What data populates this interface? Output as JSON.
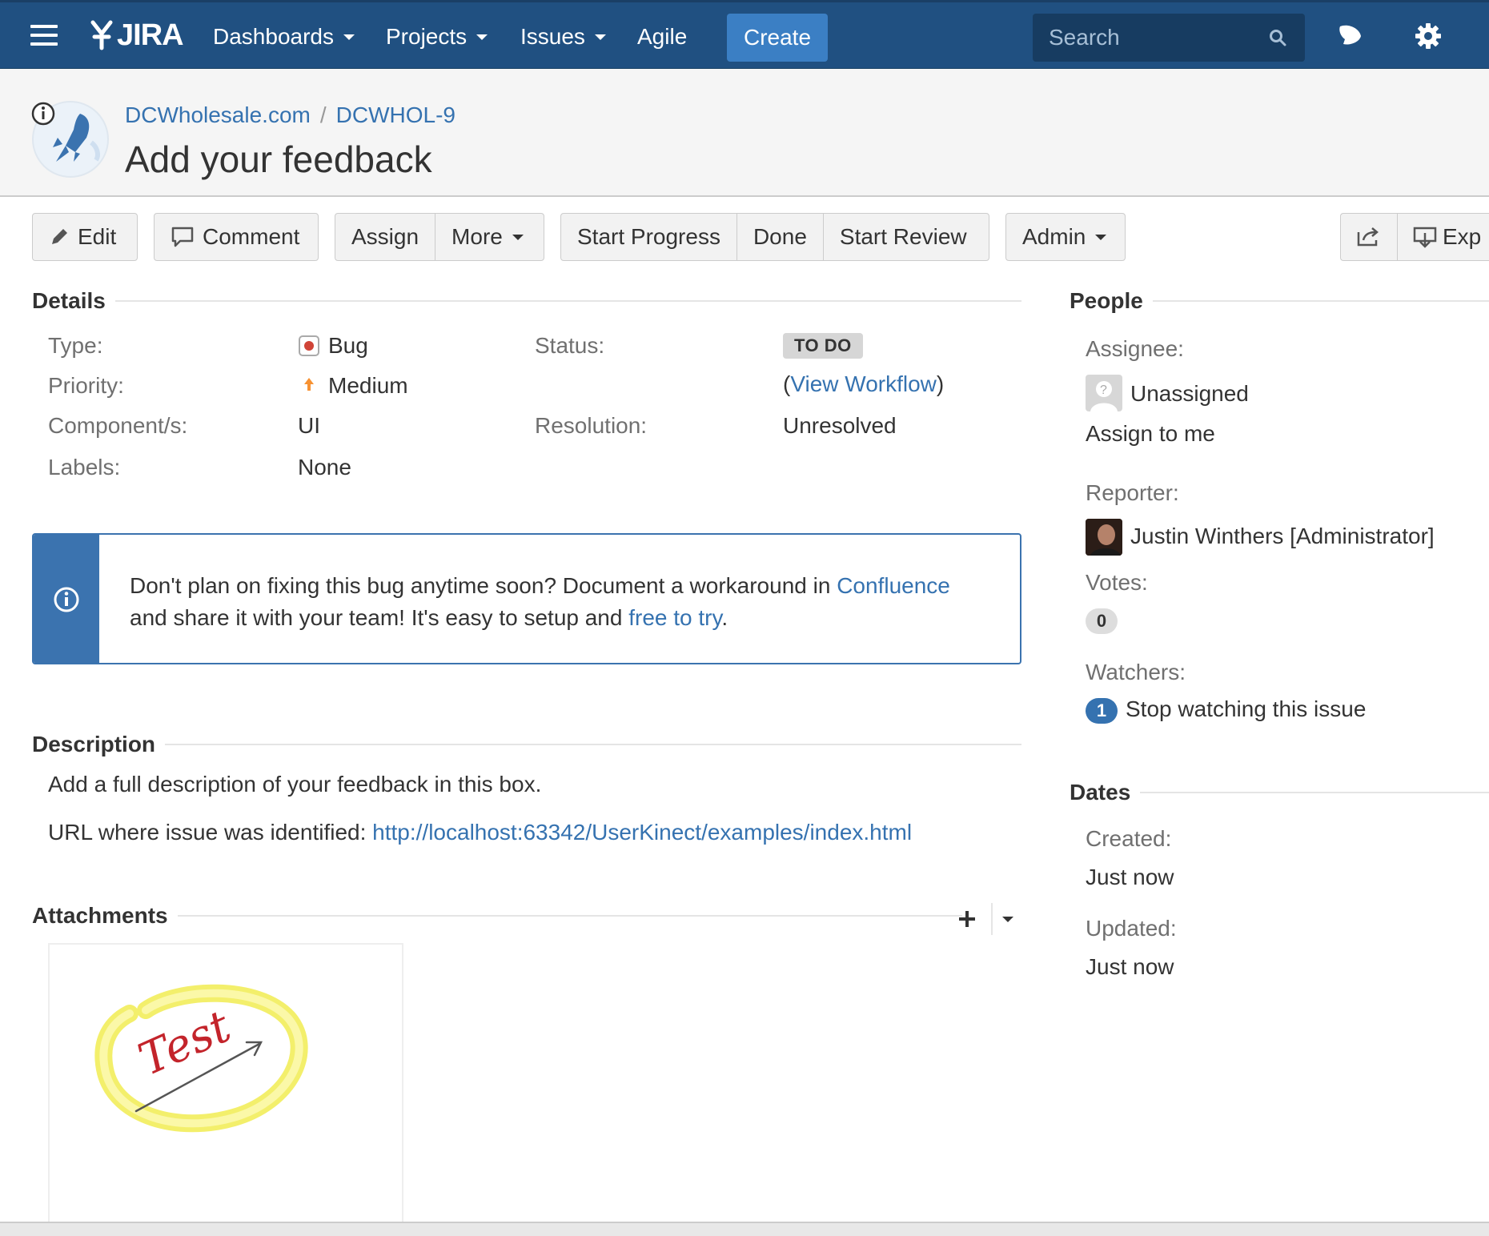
{
  "nav": {
    "logo": "JIRA",
    "items": [
      {
        "label": "Dashboards"
      },
      {
        "label": "Projects"
      },
      {
        "label": "Issues"
      },
      {
        "label": "Agile"
      }
    ],
    "create": "Create",
    "search_placeholder": "Search"
  },
  "issue": {
    "project": "DCWholesale.com",
    "key": "DCWHOL-9",
    "summary": "Add your feedback"
  },
  "toolbar": {
    "edit": "Edit",
    "comment": "Comment",
    "assign": "Assign",
    "more": "More",
    "start_progress": "Start Progress",
    "done": "Done",
    "start_review": "Start Review",
    "admin": "Admin",
    "export": "Exp"
  },
  "details": {
    "title": "Details",
    "type_label": "Type:",
    "type_value": "Bug",
    "priority_label": "Priority:",
    "priority_value": "Medium",
    "components_label": "Component/s:",
    "components_value": "UI",
    "labels_label": "Labels:",
    "labels_value": "None",
    "status_label": "Status:",
    "status_value": "TO DO",
    "view_workflow": "View Workflow",
    "resolution_label": "Resolution:",
    "resolution_value": "Unresolved"
  },
  "message": {
    "line1_prefix": "Don't plan on fixing this bug anytime soon? Document a workaround in ",
    "line1_link": "Confluence",
    "line2_prefix": "and share it with your team! It's easy to setup and ",
    "line2_link": "free to try",
    "line2_suffix": "."
  },
  "description": {
    "title": "Description",
    "line1": "Add a full description of your feedback in this box.",
    "url_label": "URL where issue was identified: ",
    "url": "http://localhost:63342/UserKinect/examples/index.html"
  },
  "attachments": {
    "title": "Attachments",
    "sketch_text": "Test"
  },
  "people": {
    "title": "People",
    "assignee_label": "Assignee:",
    "assignee_value": "Unassigned",
    "assign_to_me": "Assign to me",
    "reporter_label": "Reporter:",
    "reporter_value": "Justin Winthers [Administrator]",
    "votes_label": "Votes:",
    "votes_count": "0",
    "watchers_label": "Watchers:",
    "watchers_count": "1",
    "stop_watching": "Stop watching this issue"
  },
  "dates": {
    "title": "Dates",
    "created_label": "Created:",
    "created_value": "Just now",
    "updated_label": "Updated:",
    "updated_value": "Just now"
  },
  "colors": {
    "header": "#205081",
    "create": "#3b7fc4",
    "link": "#3572b0",
    "info": "#3b73af"
  }
}
